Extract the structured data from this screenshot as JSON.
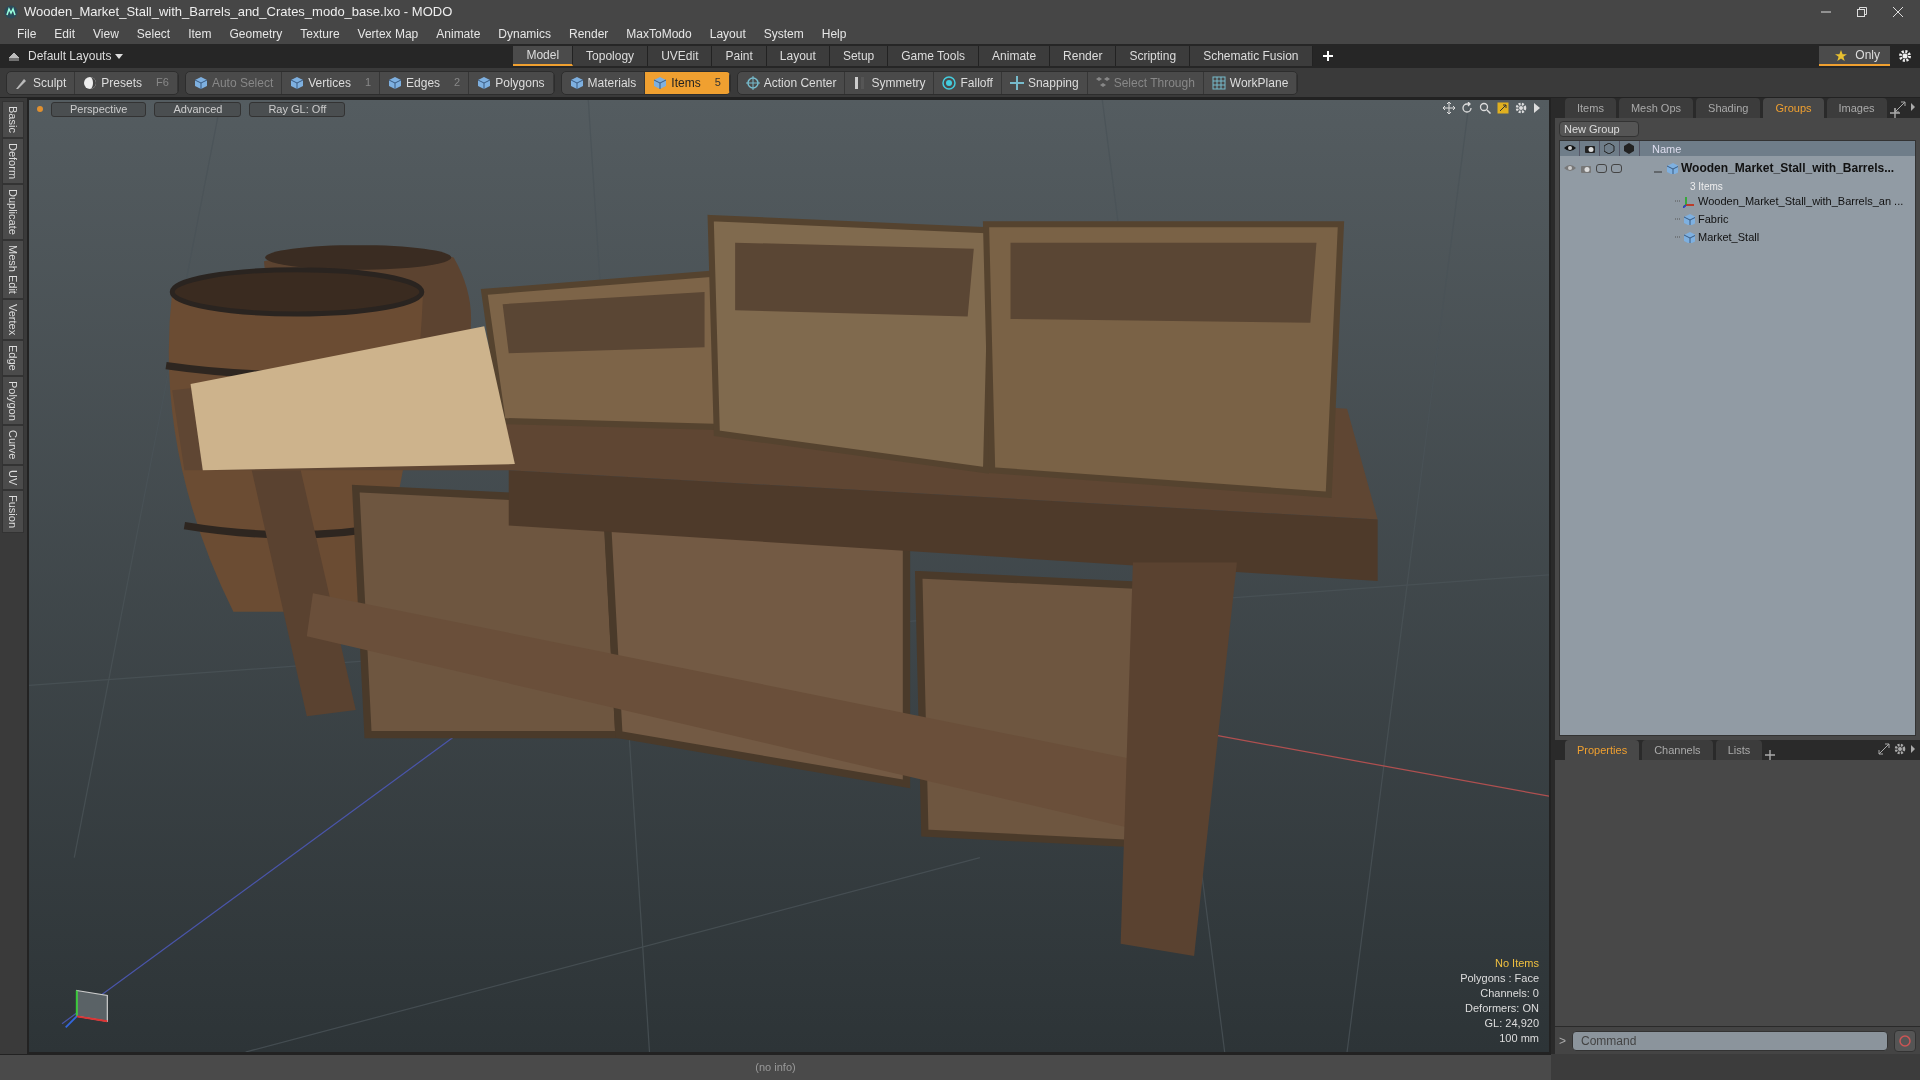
{
  "window": {
    "title": "Wooden_Market_Stall_with_Barrels_and_Crates_modo_base.lxo - MODO"
  },
  "menu": [
    "File",
    "Edit",
    "View",
    "Select",
    "Item",
    "Geometry",
    "Texture",
    "Vertex Map",
    "Animate",
    "Dynamics",
    "Render",
    "MaxToModo",
    "Layout",
    "System",
    "Help"
  ],
  "layout_bar": {
    "layouts_label": "Default Layouts",
    "tabs": [
      {
        "label": "Model",
        "selected": true
      },
      {
        "label": "Topology",
        "selected": false
      },
      {
        "label": "UVEdit",
        "selected": false
      },
      {
        "label": "Paint",
        "selected": false
      },
      {
        "label": "Layout",
        "selected": false
      },
      {
        "label": "Setup",
        "selected": false
      },
      {
        "label": "Game Tools",
        "selected": false
      },
      {
        "label": "Animate",
        "selected": false
      },
      {
        "label": "Render",
        "selected": false
      },
      {
        "label": "Scripting",
        "selected": false
      },
      {
        "label": "Schematic Fusion",
        "selected": false
      }
    ],
    "only_label": "Only"
  },
  "toolbar": {
    "groups": [
      {
        "tools": [
          {
            "label": "Sculpt",
            "kind": "brush",
            "selected": false,
            "disabled": false
          },
          {
            "label": "Presets",
            "shortcut": "F6",
            "kind": "sphere",
            "selected": false,
            "disabled": false
          }
        ]
      },
      {
        "tools": [
          {
            "label": "Auto Select",
            "kind": "cube",
            "selected": false,
            "disabled": true
          },
          {
            "label": "Vertices",
            "shortcut": "1",
            "kind": "cube",
            "selected": false,
            "disabled": false
          },
          {
            "label": "Edges",
            "shortcut": "2",
            "kind": "cube",
            "selected": false,
            "disabled": false
          },
          {
            "label": "Polygons",
            "kind": "cube",
            "selected": false,
            "disabled": false
          }
        ]
      },
      {
        "tools": [
          {
            "label": "Materials",
            "kind": "cube",
            "selected": false,
            "disabled": false
          },
          {
            "label": "Items",
            "shortcut": "5",
            "kind": "cube",
            "selected": true,
            "disabled": false
          }
        ]
      },
      {
        "tools": [
          {
            "label": "Action Center",
            "kind": "target",
            "selected": false,
            "disabled": false
          },
          {
            "label": "Symmetry",
            "kind": "symmetry",
            "selected": false,
            "disabled": false
          },
          {
            "label": "Falloff",
            "kind": "falloff",
            "selected": false,
            "disabled": false
          },
          {
            "label": "Snapping",
            "kind": "snap",
            "selected": false,
            "disabled": false
          },
          {
            "label": "Select Through",
            "kind": "cluster",
            "selected": false,
            "disabled": true
          },
          {
            "label": "WorkPlane",
            "kind": "grid",
            "selected": false,
            "disabled": false
          }
        ]
      }
    ]
  },
  "left_tabs": [
    "Basic",
    "Deform",
    "Duplicate",
    "Mesh Edit",
    "Vertex",
    "Edge",
    "Polygon",
    "Curve",
    "UV",
    "Fusion"
  ],
  "viewport": {
    "buttons": [
      "Perspective",
      "Advanced",
      "Ray GL: Off"
    ],
    "info_title": "No Items",
    "info_lines": [
      "Polygons : Face",
      "Channels: 0",
      "Deformers: ON",
      "GL: 24,920",
      "100 mm"
    ]
  },
  "items_panel": {
    "tabs": [
      {
        "label": "Items",
        "selected": false
      },
      {
        "label": "Mesh Ops",
        "selected": false
      },
      {
        "label": "Shading",
        "selected": false
      },
      {
        "label": "Groups",
        "selected": true
      },
      {
        "label": "Images",
        "selected": false
      }
    ],
    "new_group_button": "New Group",
    "name_column": "Name",
    "tree": [
      {
        "name": "Wooden_Market_Stall_with_Barrels...",
        "count": "3 Items",
        "expanded": true,
        "children": [
          {
            "name": "Wooden_Market_Stall_with_Barrels_an ...",
            "kind": "locator"
          },
          {
            "name": "Fabric",
            "kind": "mesh"
          },
          {
            "name": "Market_Stall",
            "kind": "mesh"
          }
        ]
      }
    ]
  },
  "properties_panel": {
    "tabs": [
      {
        "label": "Properties",
        "selected": true
      },
      {
        "label": "Channels",
        "selected": false
      },
      {
        "label": "Lists",
        "selected": false
      }
    ]
  },
  "command": {
    "prompt": ">",
    "placeholder": "Command"
  },
  "status_bar": {
    "text": "(no info)"
  }
}
